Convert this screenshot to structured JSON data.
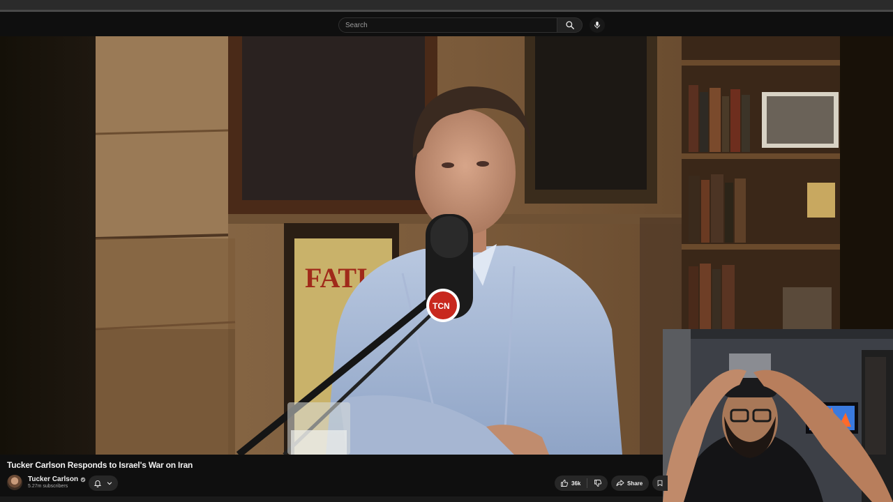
{
  "search": {
    "placeholder": "Search"
  },
  "video": {
    "title": "Tucker Carlson Responds to Israel's War on Iran",
    "sign_text": "FATI",
    "mic_logo": "TCN"
  },
  "channel": {
    "name": "Tucker Carlson",
    "subscribers": "5.27m subscribers",
    "verified": true
  },
  "actions": {
    "like_count": "36k",
    "share_label": "Share"
  },
  "icons": [
    "search-icon",
    "mic-icon",
    "bell-icon",
    "chevron-down-icon",
    "thumbs-up-icon",
    "thumbs-down-icon",
    "share-arrow-icon",
    "save-icon",
    "verified-icon"
  ],
  "colors": {
    "background": "#0f0f0f",
    "button": "#272727",
    "text": "#f1f1f1",
    "secondary_text": "#aaaaaa"
  }
}
